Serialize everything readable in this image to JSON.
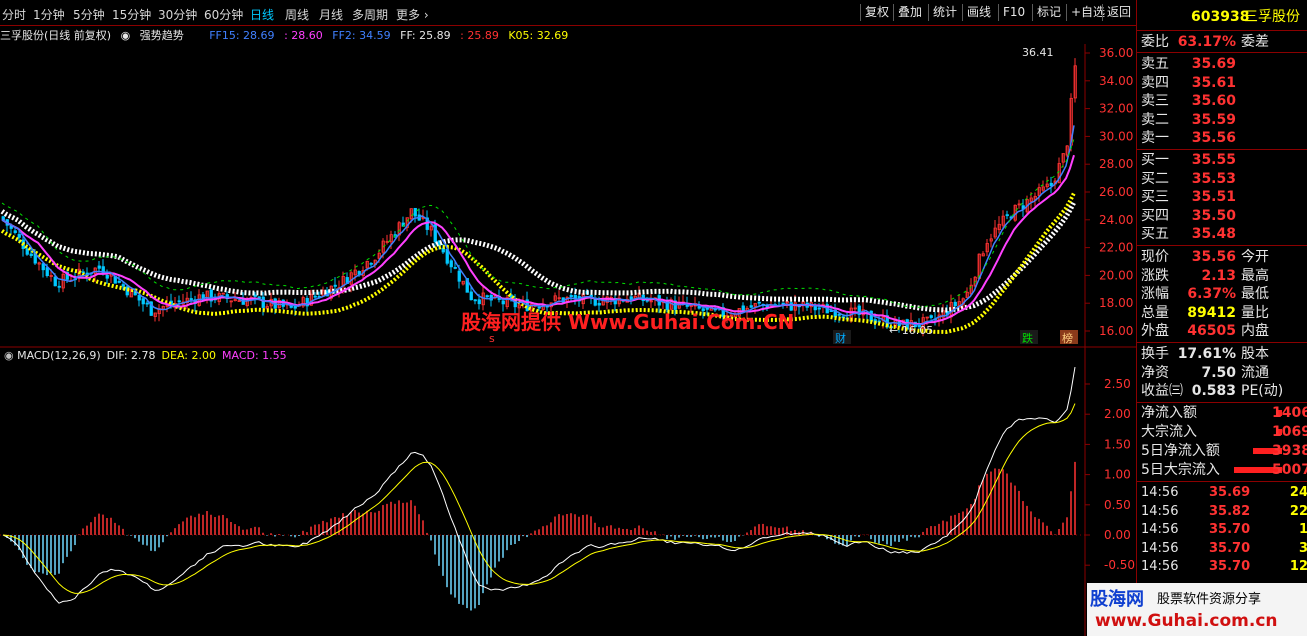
{
  "toolbar": {
    "periods": [
      "分时",
      "1分钟",
      "5分钟",
      "15分钟",
      "30分钟",
      "60分钟",
      "日线",
      "周线",
      "月线",
      "多周期",
      "更多"
    ],
    "active_period": "日线",
    "buttons": [
      "复权",
      "叠加",
      "统计",
      "画线",
      "F10",
      "标记",
      "+自选",
      "返回"
    ]
  },
  "chart_header": {
    "title": "三孚股份(日线 前复权)",
    "indicator_name": "强势趋势",
    "ff15": "FF15: 28.69",
    "ff15b": ": 28.60",
    "ff2": "FF2: 34.59",
    "ff": "FF: 25.89",
    "ffb": ": 25.89",
    "k05": "K05: 32.69"
  },
  "price_axis": [
    "36.00",
    "34.00",
    "32.00",
    "30.00",
    "28.00",
    "26.00",
    "24.00",
    "22.00",
    "20.00",
    "18.00",
    "16.00"
  ],
  "macd_axis": [
    "2.50",
    "2.00",
    "1.50",
    "1.00",
    "0.50",
    "0.00",
    "-0.50"
  ],
  "annotations": {
    "high": "36.41",
    "low": "← 16.05",
    "tag_cai": "财",
    "tag_die": "跌",
    "tag_bang": "榜",
    "tag_s": "s"
  },
  "macd_header": {
    "name": "MACD(12,26,9)",
    "dif": "DIF: 2.78",
    "dea": "DEA: 2.00",
    "macd": "MACD: 1.55"
  },
  "watermark": "股海网提供 Www.Guhai.Com.CN",
  "logo": {
    "name": "股海网",
    "slogan": "股票软件资源分享",
    "url": "www.Guhai.com.cn"
  },
  "panel": {
    "code": "603938",
    "name": "三孚股份",
    "weibi_label": "委比",
    "weibi_value": "63.17%",
    "weicha_label": "委差",
    "asks": [
      {
        "label": "卖五",
        "price": "35.69"
      },
      {
        "label": "卖四",
        "price": "35.61"
      },
      {
        "label": "卖三",
        "price": "35.60"
      },
      {
        "label": "卖二",
        "price": "35.59"
      },
      {
        "label": "卖一",
        "price": "35.56"
      }
    ],
    "bids": [
      {
        "label": "买一",
        "price": "35.55"
      },
      {
        "label": "买二",
        "price": "35.53"
      },
      {
        "label": "买三",
        "price": "35.51"
      },
      {
        "label": "买四",
        "price": "35.50"
      },
      {
        "label": "买五",
        "price": "35.48"
      }
    ],
    "stats": [
      {
        "label": "现价",
        "value": "35.56",
        "label2": "今开",
        "color": "red"
      },
      {
        "label": "涨跌",
        "value": "2.13",
        "label2": "最高",
        "color": "red"
      },
      {
        "label": "涨幅",
        "value": "6.37%",
        "label2": "最低",
        "color": "red"
      },
      {
        "label": "总量",
        "value": "89412",
        "label2": "量比",
        "color": "yel"
      },
      {
        "label": "外盘",
        "value": "46505",
        "label2": "内盘",
        "color": "red"
      }
    ],
    "stats2": [
      {
        "label": "换手",
        "value": "17.61%",
        "label2": "股本"
      },
      {
        "label": "净资",
        "value": "7.50",
        "label2": "流通"
      },
      {
        "label": "收益㈢",
        "value": "0.583",
        "label2": "PE(动)"
      }
    ],
    "flows": [
      {
        "label": "净流入额",
        "value": "1406",
        "bar": 0.1
      },
      {
        "label": "大宗流入",
        "value": "1069",
        "bar": 0.08
      },
      {
        "label": "5日净流入额",
        "value": "3938",
        "bar": 0.6
      },
      {
        "label": "5日大宗流入",
        "value": "5007",
        "bar": 1.0
      }
    ],
    "trades": [
      {
        "time": "14:56",
        "price": "35.69",
        "vol": "24"
      },
      {
        "time": "14:56",
        "price": "35.82",
        "vol": "22"
      },
      {
        "time": "14:56",
        "price": "35.70",
        "vol": "1"
      },
      {
        "time": "14:56",
        "price": "35.70",
        "vol": "3"
      },
      {
        "time": "14:56",
        "price": "35.70",
        "vol": "12"
      }
    ]
  }
}
